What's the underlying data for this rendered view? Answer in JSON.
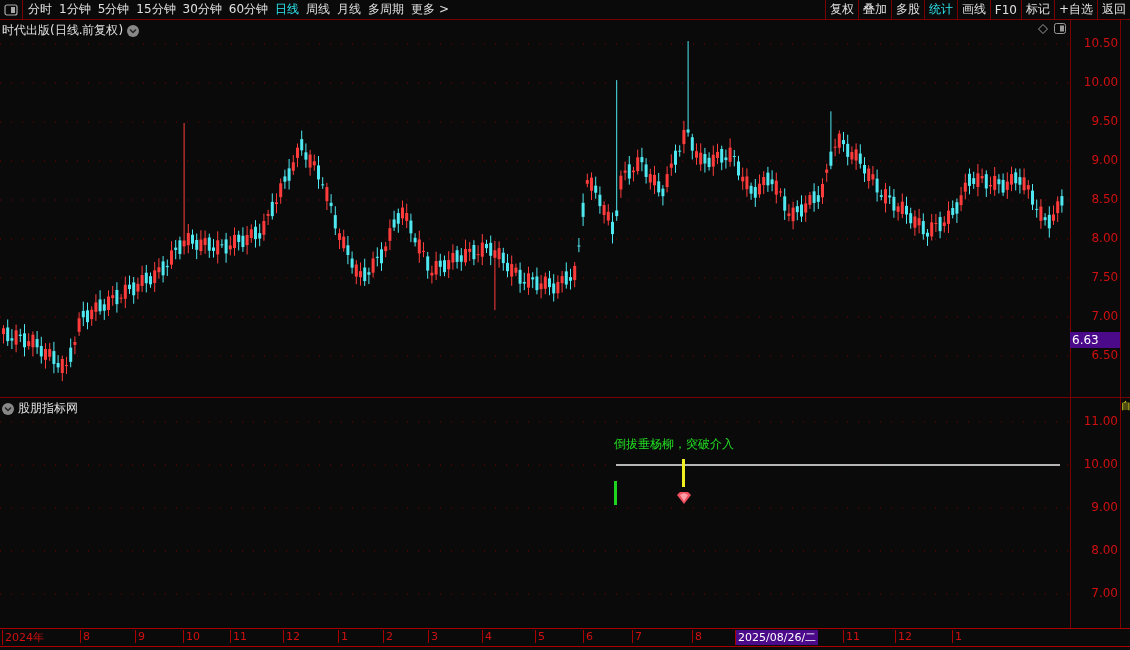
{
  "toolbar": {
    "periods": [
      {
        "label": "分时",
        "selected": false
      },
      {
        "label": "1分钟",
        "selected": false
      },
      {
        "label": "5分钟",
        "selected": false
      },
      {
        "label": "15分钟",
        "selected": false
      },
      {
        "label": "30分钟",
        "selected": false
      },
      {
        "label": "60分钟",
        "selected": false
      },
      {
        "label": "日线",
        "selected": true
      },
      {
        "label": "周线",
        "selected": false
      },
      {
        "label": "月线",
        "selected": false
      },
      {
        "label": "多周期",
        "selected": false
      },
      {
        "label": "更多 >",
        "selected": false
      }
    ],
    "buttons": [
      {
        "label": "复权",
        "selected": false
      },
      {
        "label": "叠加",
        "selected": false
      },
      {
        "label": "多股",
        "selected": false
      },
      {
        "label": "统计",
        "selected": true
      },
      {
        "label": "画线",
        "selected": false
      },
      {
        "label": "F10",
        "selected": false
      },
      {
        "label": "标记",
        "selected": false
      },
      {
        "label": "+自选",
        "selected": false
      },
      {
        "label": "返回",
        "selected": false
      }
    ]
  },
  "main_chart": {
    "title": "时代出版(日线.前复权)",
    "price_axis": [
      "10.50",
      "10.00",
      "9.50",
      "9.00",
      "8.50",
      "8.00",
      "7.50",
      "7.00",
      "6.50"
    ],
    "current_price": "6.63"
  },
  "indicator_panel": {
    "title": "股朋指标网",
    "signal_text": "倒拔垂杨柳，突破介入",
    "axis": [
      "11.00",
      "10.00",
      "9.00",
      "8.00",
      "7.00"
    ]
  },
  "side_panel": {
    "label": "自"
  },
  "date_axis": [
    {
      "label": "2024年",
      "selected": false
    },
    {
      "label": "8",
      "selected": false
    },
    {
      "label": "9",
      "selected": false
    },
    {
      "label": "10",
      "selected": false
    },
    {
      "label": "11",
      "selected": false
    },
    {
      "label": "12",
      "selected": false
    },
    {
      "label": "1",
      "selected": false
    },
    {
      "label": "2",
      "selected": false
    },
    {
      "label": "3",
      "selected": false
    },
    {
      "label": "4",
      "selected": false
    },
    {
      "label": "5",
      "selected": false
    },
    {
      "label": "6",
      "selected": false
    },
    {
      "label": "7",
      "selected": false
    },
    {
      "label": "8",
      "selected": false
    },
    {
      "label": "2025/08/26/二",
      "selected": true
    },
    {
      "label": "11",
      "selected": false
    },
    {
      "label": "12",
      "selected": false
    },
    {
      "label": "1",
      "selected": false
    }
  ]
}
